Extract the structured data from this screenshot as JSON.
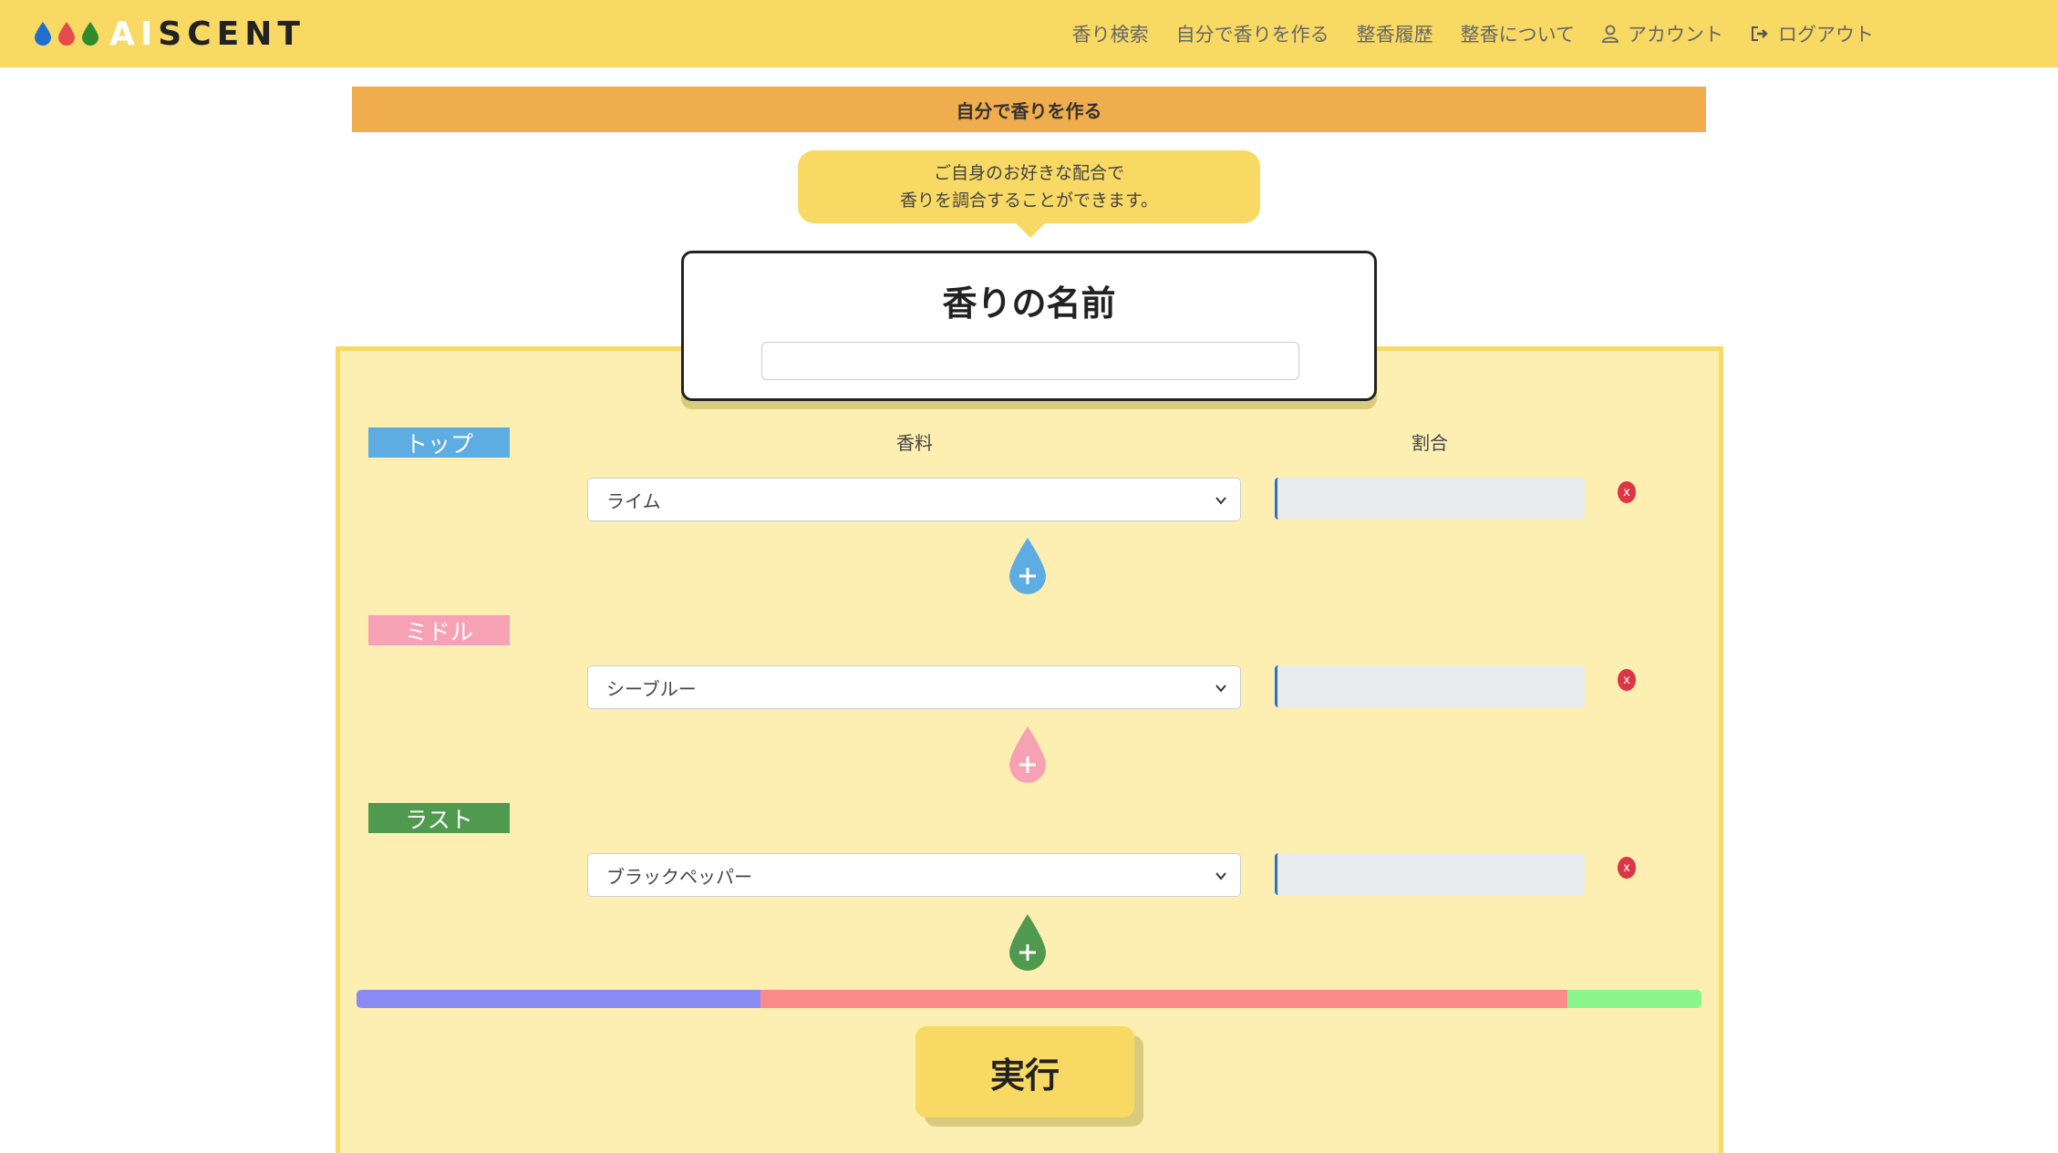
{
  "app": {
    "logo_ai": "AI",
    "logo_scent": "SCENT",
    "logo_drop_colors": [
      "#1f6fd1",
      "#e64b4b",
      "#2e8b2e"
    ]
  },
  "nav": {
    "items": [
      {
        "label": "香り検索",
        "icon": ""
      },
      {
        "label": "自分で香りを作る",
        "icon": ""
      },
      {
        "label": "整香履歴",
        "icon": ""
      },
      {
        "label": "整香について",
        "icon": ""
      },
      {
        "label": "アカウント",
        "icon": "user-icon"
      },
      {
        "label": "ログアウト",
        "icon": "logout-icon"
      }
    ]
  },
  "page": {
    "title": "自分で香りを作る",
    "bubble_line1": "ご自身のお好きな配合で",
    "bubble_line2": "香りを調合することができます。"
  },
  "name_card": {
    "title": "香りの名前",
    "input_value": ""
  },
  "columns": {
    "ingredient": "香料",
    "ratio": "割合"
  },
  "notes": [
    {
      "label": "トップ",
      "color": "#5dade2",
      "selected": "ライム",
      "ratio": "",
      "delete_label": "x",
      "add_color": "#5dade2"
    },
    {
      "label": "ミドル",
      "color": "#f7a1b5",
      "selected": "シーブルー",
      "ratio": "",
      "delete_label": "x",
      "add_color": "#f7a1b5"
    },
    {
      "label": "ラスト",
      "color": "#4f9a4f",
      "selected": "ブラックペッパー",
      "ratio": "",
      "delete_label": "x",
      "add_color": "#4f9a4f"
    }
  ],
  "progress": {
    "segments": [
      {
        "fraction": 0.3,
        "color": "#8a8af5"
      },
      {
        "fraction": 0.6,
        "color": "#fb8a8a"
      },
      {
        "fraction": 0.1,
        "color": "#8af58a"
      }
    ]
  },
  "execute_label": "実行"
}
